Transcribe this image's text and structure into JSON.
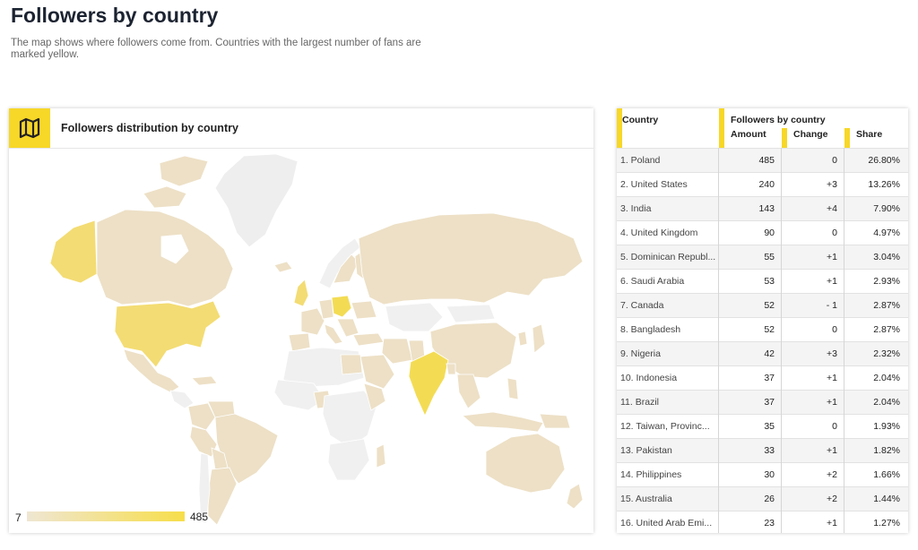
{
  "page": {
    "title": "Followers by country",
    "description": "The map shows where followers come from. Countries with the largest number of fans are marked yellow."
  },
  "map_card": {
    "title": "Followers distribution by country",
    "icon": "map-icon",
    "legend_min": "7",
    "legend_max": "485",
    "colors": {
      "accent": "#f7d727",
      "low": "#efe6d3",
      "high": "#f7de4a",
      "no_data": "#f0f0f0"
    }
  },
  "table": {
    "headers": {
      "country": "Country",
      "group": "Followers by country",
      "amount": "Amount",
      "change": "Change",
      "share": "Share"
    },
    "rows": [
      {
        "country": "1. Poland",
        "amount": "485",
        "change": "0",
        "share": "26.80%"
      },
      {
        "country": "2. United States",
        "amount": "240",
        "change": "+3",
        "share": "13.26%"
      },
      {
        "country": "3. India",
        "amount": "143",
        "change": "+4",
        "share": "7.90%"
      },
      {
        "country": "4. United Kingdom",
        "amount": "90",
        "change": "0",
        "share": "4.97%"
      },
      {
        "country": "5. Dominican Republ...",
        "amount": "55",
        "change": "+1",
        "share": "3.04%"
      },
      {
        "country": "6. Saudi Arabia",
        "amount": "53",
        "change": "+1",
        "share": "2.93%"
      },
      {
        "country": "7. Canada",
        "amount": "52",
        "change": "- 1",
        "share": "2.87%"
      },
      {
        "country": "8. Bangladesh",
        "amount": "52",
        "change": "0",
        "share": "2.87%"
      },
      {
        "country": "9. Nigeria",
        "amount": "42",
        "change": "+3",
        "share": "2.32%"
      },
      {
        "country": "10. Indonesia",
        "amount": "37",
        "change": "+1",
        "share": "2.04%"
      },
      {
        "country": "11. Brazil",
        "amount": "37",
        "change": "+1",
        "share": "2.04%"
      },
      {
        "country": "12. Taiwan, Provinc...",
        "amount": "35",
        "change": "0",
        "share": "1.93%"
      },
      {
        "country": "13. Pakistan",
        "amount": "33",
        "change": "+1",
        "share": "1.82%"
      },
      {
        "country": "14. Philippines",
        "amount": "30",
        "change": "+2",
        "share": "1.66%"
      },
      {
        "country": "15. Australia",
        "amount": "26",
        "change": "+2",
        "share": "1.44%"
      },
      {
        "country": "16. United Arab Emi...",
        "amount": "23",
        "change": "+1",
        "share": "1.27%"
      }
    ]
  }
}
